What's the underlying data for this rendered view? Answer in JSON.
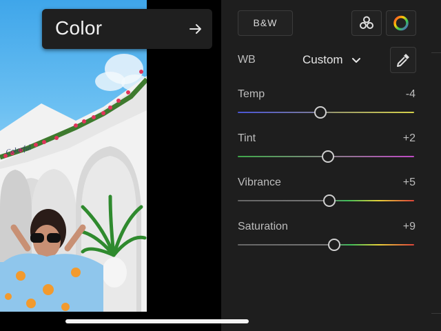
{
  "tooltip": {
    "label": "Color",
    "icon": "arrow-right-icon"
  },
  "header": {
    "bw_label": "B&W",
    "mixer_icon": "color-mixer-icon",
    "grading_icon": "color-wheel-icon"
  },
  "white_balance": {
    "label": "WB",
    "value": "Custom",
    "picker_icon": "eyedropper-icon"
  },
  "sliders": [
    {
      "label": "Temp",
      "value": "-4",
      "level": 0.47
    },
    {
      "label": "Tint",
      "value": "+2",
      "level": 0.51
    },
    {
      "label": "Vibrance",
      "value": "+5",
      "level": 0.52
    },
    {
      "label": "Saturation",
      "value": "+9",
      "level": 0.545
    }
  ],
  "photo": {
    "sign_text": "Colorful"
  },
  "colors": {
    "panel_bg": "#1e1e1e",
    "tooltip_bg": "#1f1f1f",
    "thumb": "#cfcfcf"
  }
}
